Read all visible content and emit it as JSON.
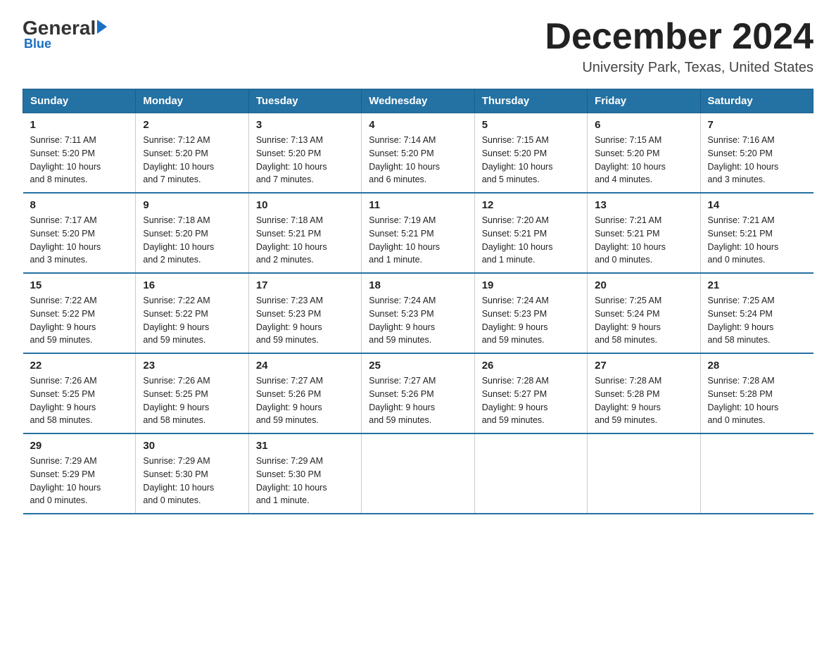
{
  "header": {
    "logo_general": "General",
    "logo_blue": "Blue",
    "main_title": "December 2024",
    "subtitle": "University Park, Texas, United States"
  },
  "weekdays": [
    "Sunday",
    "Monday",
    "Tuesday",
    "Wednesday",
    "Thursday",
    "Friday",
    "Saturday"
  ],
  "weeks": [
    [
      {
        "day": "1",
        "info": "Sunrise: 7:11 AM\nSunset: 5:20 PM\nDaylight: 10 hours\nand 8 minutes."
      },
      {
        "day": "2",
        "info": "Sunrise: 7:12 AM\nSunset: 5:20 PM\nDaylight: 10 hours\nand 7 minutes."
      },
      {
        "day": "3",
        "info": "Sunrise: 7:13 AM\nSunset: 5:20 PM\nDaylight: 10 hours\nand 7 minutes."
      },
      {
        "day": "4",
        "info": "Sunrise: 7:14 AM\nSunset: 5:20 PM\nDaylight: 10 hours\nand 6 minutes."
      },
      {
        "day": "5",
        "info": "Sunrise: 7:15 AM\nSunset: 5:20 PM\nDaylight: 10 hours\nand 5 minutes."
      },
      {
        "day": "6",
        "info": "Sunrise: 7:15 AM\nSunset: 5:20 PM\nDaylight: 10 hours\nand 4 minutes."
      },
      {
        "day": "7",
        "info": "Sunrise: 7:16 AM\nSunset: 5:20 PM\nDaylight: 10 hours\nand 3 minutes."
      }
    ],
    [
      {
        "day": "8",
        "info": "Sunrise: 7:17 AM\nSunset: 5:20 PM\nDaylight: 10 hours\nand 3 minutes."
      },
      {
        "day": "9",
        "info": "Sunrise: 7:18 AM\nSunset: 5:20 PM\nDaylight: 10 hours\nand 2 minutes."
      },
      {
        "day": "10",
        "info": "Sunrise: 7:18 AM\nSunset: 5:21 PM\nDaylight: 10 hours\nand 2 minutes."
      },
      {
        "day": "11",
        "info": "Sunrise: 7:19 AM\nSunset: 5:21 PM\nDaylight: 10 hours\nand 1 minute."
      },
      {
        "day": "12",
        "info": "Sunrise: 7:20 AM\nSunset: 5:21 PM\nDaylight: 10 hours\nand 1 minute."
      },
      {
        "day": "13",
        "info": "Sunrise: 7:21 AM\nSunset: 5:21 PM\nDaylight: 10 hours\nand 0 minutes."
      },
      {
        "day": "14",
        "info": "Sunrise: 7:21 AM\nSunset: 5:21 PM\nDaylight: 10 hours\nand 0 minutes."
      }
    ],
    [
      {
        "day": "15",
        "info": "Sunrise: 7:22 AM\nSunset: 5:22 PM\nDaylight: 9 hours\nand 59 minutes."
      },
      {
        "day": "16",
        "info": "Sunrise: 7:22 AM\nSunset: 5:22 PM\nDaylight: 9 hours\nand 59 minutes."
      },
      {
        "day": "17",
        "info": "Sunrise: 7:23 AM\nSunset: 5:23 PM\nDaylight: 9 hours\nand 59 minutes."
      },
      {
        "day": "18",
        "info": "Sunrise: 7:24 AM\nSunset: 5:23 PM\nDaylight: 9 hours\nand 59 minutes."
      },
      {
        "day": "19",
        "info": "Sunrise: 7:24 AM\nSunset: 5:23 PM\nDaylight: 9 hours\nand 59 minutes."
      },
      {
        "day": "20",
        "info": "Sunrise: 7:25 AM\nSunset: 5:24 PM\nDaylight: 9 hours\nand 58 minutes."
      },
      {
        "day": "21",
        "info": "Sunrise: 7:25 AM\nSunset: 5:24 PM\nDaylight: 9 hours\nand 58 minutes."
      }
    ],
    [
      {
        "day": "22",
        "info": "Sunrise: 7:26 AM\nSunset: 5:25 PM\nDaylight: 9 hours\nand 58 minutes."
      },
      {
        "day": "23",
        "info": "Sunrise: 7:26 AM\nSunset: 5:25 PM\nDaylight: 9 hours\nand 58 minutes."
      },
      {
        "day": "24",
        "info": "Sunrise: 7:27 AM\nSunset: 5:26 PM\nDaylight: 9 hours\nand 59 minutes."
      },
      {
        "day": "25",
        "info": "Sunrise: 7:27 AM\nSunset: 5:26 PM\nDaylight: 9 hours\nand 59 minutes."
      },
      {
        "day": "26",
        "info": "Sunrise: 7:28 AM\nSunset: 5:27 PM\nDaylight: 9 hours\nand 59 minutes."
      },
      {
        "day": "27",
        "info": "Sunrise: 7:28 AM\nSunset: 5:28 PM\nDaylight: 9 hours\nand 59 minutes."
      },
      {
        "day": "28",
        "info": "Sunrise: 7:28 AM\nSunset: 5:28 PM\nDaylight: 10 hours\nand 0 minutes."
      }
    ],
    [
      {
        "day": "29",
        "info": "Sunrise: 7:29 AM\nSunset: 5:29 PM\nDaylight: 10 hours\nand 0 minutes."
      },
      {
        "day": "30",
        "info": "Sunrise: 7:29 AM\nSunset: 5:30 PM\nDaylight: 10 hours\nand 0 minutes."
      },
      {
        "day": "31",
        "info": "Sunrise: 7:29 AM\nSunset: 5:30 PM\nDaylight: 10 hours\nand 1 minute."
      },
      null,
      null,
      null,
      null
    ]
  ]
}
